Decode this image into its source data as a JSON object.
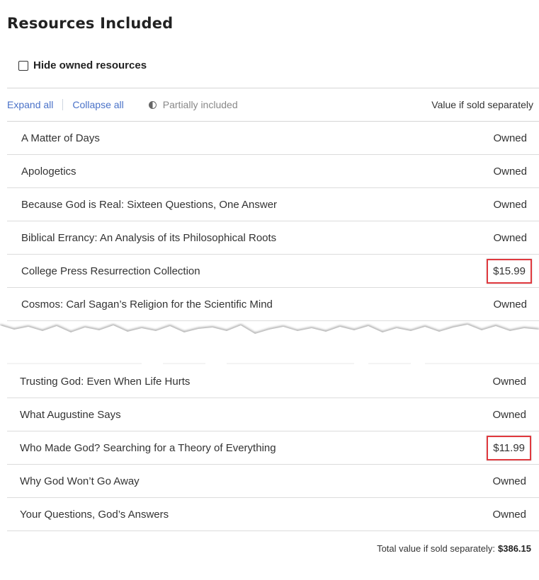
{
  "page": {
    "title": "Resources Included",
    "hide_owned_label": "Hide owned resources",
    "hide_owned_checked": false
  },
  "toolbar": {
    "expand_all": "Expand all",
    "collapse_all": "Collapse all",
    "partially_included": "Partially included",
    "value_header": "Value if sold separately"
  },
  "resources_top": [
    {
      "name": "A Matter of Days",
      "value": "Owned",
      "highlighted": false
    },
    {
      "name": "Apologetics",
      "value": "Owned",
      "highlighted": false
    },
    {
      "name": "Because God is Real: Sixteen Questions, One Answer",
      "value": "Owned",
      "highlighted": false
    },
    {
      "name": "Biblical Errancy: An Analysis of its Philosophical Roots",
      "value": "Owned",
      "highlighted": false
    },
    {
      "name": "College Press Resurrection Collection",
      "value": "$15.99",
      "highlighted": true
    },
    {
      "name": "Cosmos: Carl Sagan’s Religion for the Scientific Mind",
      "value": "Owned",
      "highlighted": false
    }
  ],
  "resources_bottom": [
    {
      "name": "Trusting God: Even When Life Hurts",
      "value": "Owned",
      "highlighted": false
    },
    {
      "name": "What Augustine Says",
      "value": "Owned",
      "highlighted": false
    },
    {
      "name": "Who Made God? Searching for a Theory of Everything",
      "value": "$11.99",
      "highlighted": true
    },
    {
      "name": "Why God Won’t Go Away",
      "value": "Owned",
      "highlighted": false
    },
    {
      "name": "Your Questions, God’s Answers",
      "value": "Owned",
      "highlighted": false
    }
  ],
  "total": {
    "label": "Total value if sold separately:",
    "value": "$386.15"
  },
  "colors": {
    "link": "#4a72c8",
    "highlight_border": "#e0393e"
  }
}
